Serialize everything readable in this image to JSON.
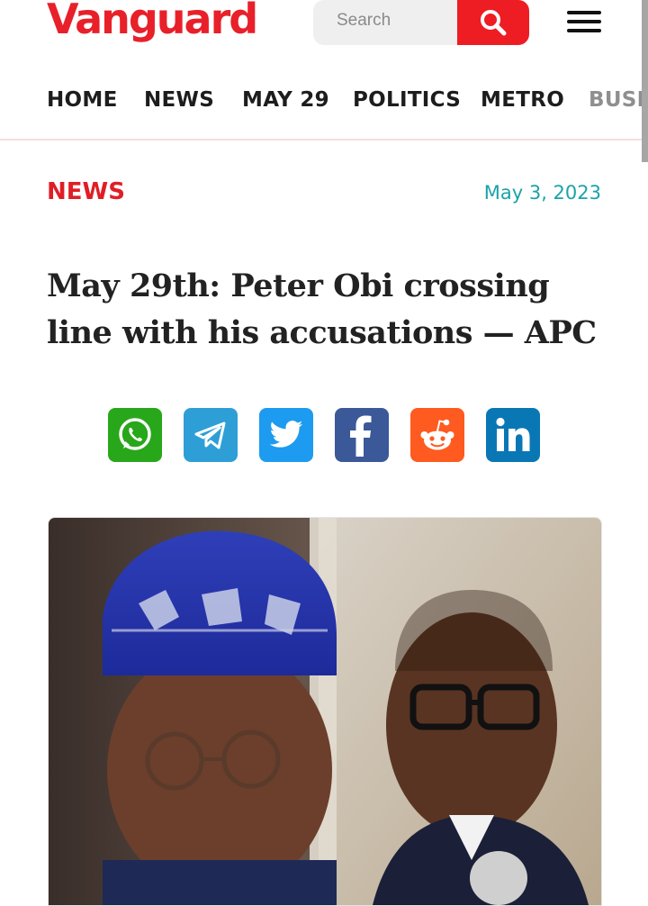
{
  "header": {
    "logo_text": "Vanguard",
    "brand_color": "#e8202a",
    "search_placeholder": "Search",
    "search_icon": "search-icon",
    "menu_icon": "hamburger-menu-icon"
  },
  "nav": {
    "items": [
      "HOME",
      "NEWS",
      "MAY 29",
      "POLITICS",
      "METRO",
      "BUSIN"
    ]
  },
  "article": {
    "category": "NEWS",
    "date": "May 3, 2023",
    "headline": "May 29th: Peter Obi crossing line with his accusations — APC"
  },
  "share": {
    "buttons": [
      {
        "name": "whatsapp",
        "icon": "whatsapp-icon",
        "color": "#29a71a"
      },
      {
        "name": "telegram",
        "icon": "telegram-icon",
        "color": "#2e9fd6"
      },
      {
        "name": "twitter",
        "icon": "twitter-icon",
        "color": "#1d9bf0"
      },
      {
        "name": "facebook",
        "icon": "facebook-icon",
        "color": "#3b5998"
      },
      {
        "name": "reddit",
        "icon": "reddit-icon",
        "color": "#ff5a1f"
      },
      {
        "name": "linkedin",
        "icon": "linkedin-icon",
        "color": "#0a77b5"
      }
    ]
  },
  "colors": {
    "category": "#e01e26",
    "date": "#1aa3a9",
    "search_button": "#ee1d23"
  }
}
